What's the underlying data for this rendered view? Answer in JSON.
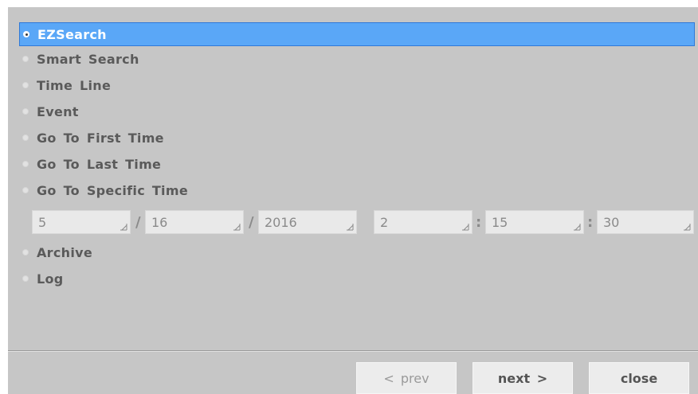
{
  "options": [
    {
      "label": "EZSearch",
      "selected": true
    },
    {
      "label": "Smart Search",
      "selected": false
    },
    {
      "label": "Time Line",
      "selected": false
    },
    {
      "label": "Event",
      "selected": false
    },
    {
      "label": "Go To First Time",
      "selected": false
    },
    {
      "label": "Go To Last Time",
      "selected": false
    },
    {
      "label": "Go To Specific Time",
      "selected": false
    },
    {
      "label": "Archive",
      "selected": false
    },
    {
      "label": "Log",
      "selected": false
    }
  ],
  "specific_time": {
    "month": "5",
    "day": "16",
    "year": "2016",
    "hour": "2",
    "minute": "15",
    "second": "30",
    "date_sep": "/",
    "time_sep": ":"
  },
  "buttons": {
    "prev": "< prev",
    "next": "next >",
    "close": "close"
  },
  "colors": {
    "panel": "#c6c6c6",
    "selection": "#5aa7f7",
    "field": "#e9e9e9",
    "button": "#ececec"
  }
}
